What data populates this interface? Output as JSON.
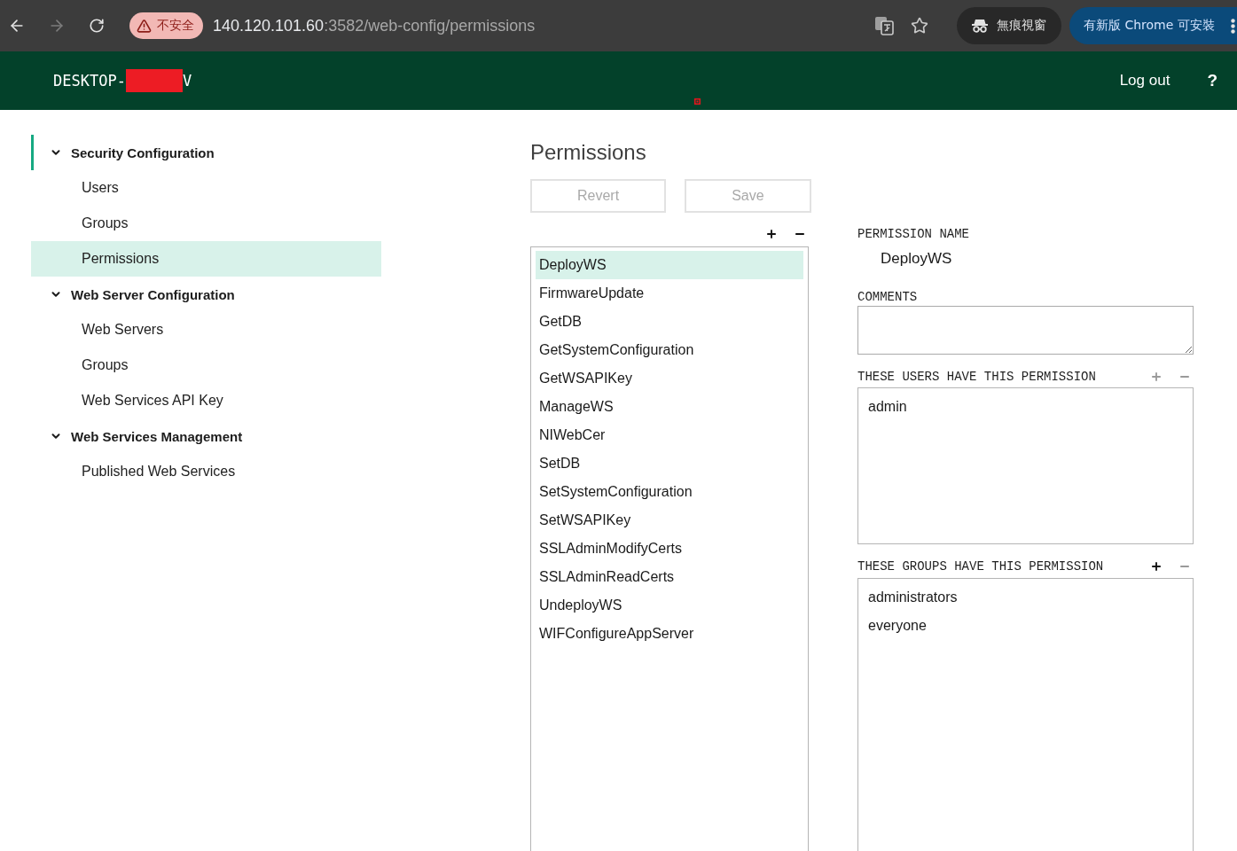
{
  "browser": {
    "nav_buttons": [
      {
        "kind": "back",
        "disabled": false
      },
      {
        "kind": "forward",
        "disabled": true
      },
      {
        "kind": "reload",
        "disabled": false
      }
    ],
    "security_chip": "不安全",
    "url": {
      "host": "140.120.101.60",
      "path": ":3582/web-config/permissions"
    },
    "incognito_label": "無痕視窗",
    "update_button": "有新版 Chrome 可安裝"
  },
  "header": {
    "hostname_prefix": "DESKTOP-",
    "redacted": true,
    "hostname_suffix": "V",
    "logout": "Log out",
    "help": "?"
  },
  "sidebar": {
    "sections": [
      {
        "label": "Security Configuration",
        "expanded": true,
        "focused": true,
        "children": [
          {
            "label": "Users",
            "selected": false
          },
          {
            "label": "Groups",
            "selected": false
          },
          {
            "label": "Permissions",
            "selected": true
          }
        ]
      },
      {
        "label": "Web Server Configuration",
        "expanded": true,
        "focused": false,
        "children": [
          {
            "label": "Web Servers",
            "selected": false
          },
          {
            "label": "Groups",
            "selected": false
          },
          {
            "label": "Web Services API Key",
            "selected": false
          }
        ]
      },
      {
        "label": "Web Services Management",
        "expanded": true,
        "focused": false,
        "children": [
          {
            "label": "Published Web Services",
            "selected": false
          }
        ]
      }
    ]
  },
  "page": {
    "title": "Permissions",
    "buttons": [
      {
        "label": "Revert",
        "disabled": true
      },
      {
        "label": "Save",
        "disabled": true
      }
    ]
  },
  "permission_list": {
    "add_disabled": false,
    "remove_disabled": false,
    "items": [
      {
        "label": "DeployWS",
        "selected": true
      },
      {
        "label": "FirmwareUpdate",
        "selected": false
      },
      {
        "label": "GetDB",
        "selected": false
      },
      {
        "label": "GetSystemConfiguration",
        "selected": false
      },
      {
        "label": "GetWSAPIKey",
        "selected": false
      },
      {
        "label": "ManageWS",
        "selected": false
      },
      {
        "label": "NIWebCer",
        "selected": false
      },
      {
        "label": "SetDB",
        "selected": false
      },
      {
        "label": "SetSystemConfiguration",
        "selected": false
      },
      {
        "label": "SetWSAPIKey",
        "selected": false
      },
      {
        "label": "SSLAdminModifyCerts",
        "selected": false
      },
      {
        "label": "SSLAdminReadCerts",
        "selected": false
      },
      {
        "label": "UndeployWS",
        "selected": false
      },
      {
        "label": "WIFConfigureAppServer",
        "selected": false
      }
    ]
  },
  "details": {
    "name_label": "PERMISSION NAME",
    "name_value": "DeployWS",
    "comments_label": "COMMENTS",
    "users": {
      "label": "THESE USERS HAVE THIS PERMISSION",
      "add_disabled": true,
      "remove_disabled": true,
      "items": [
        {
          "label": "admin",
          "selected": false
        }
      ]
    },
    "groups": {
      "label": "THESE GROUPS HAVE THIS PERMISSION",
      "add_disabled": false,
      "remove_disabled": true,
      "items": [
        {
          "label": "administrators",
          "selected": false
        },
        {
          "label": "everyone",
          "selected": false
        }
      ]
    }
  }
}
